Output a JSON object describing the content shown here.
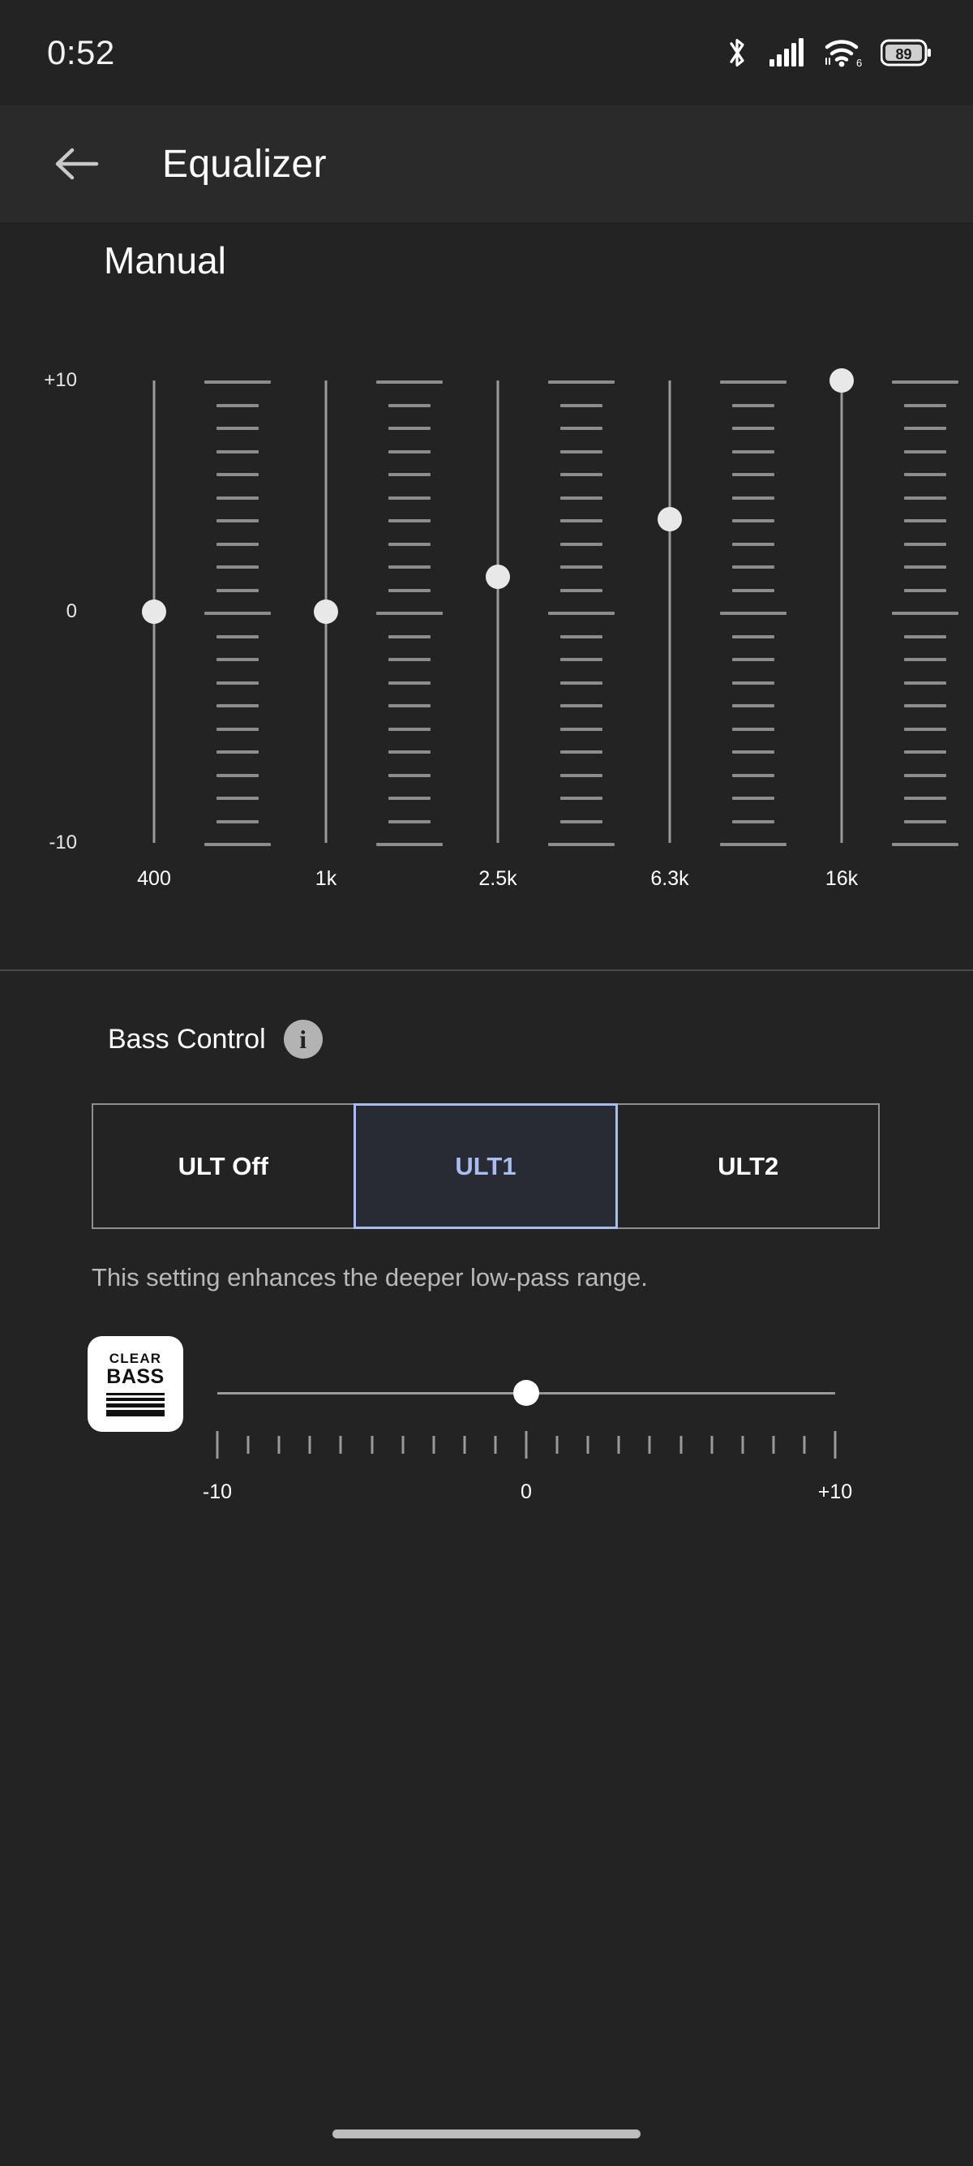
{
  "status_bar": {
    "time": "0:52",
    "battery_percent": "89",
    "wifi_generation": "6",
    "icons": [
      "bluetooth-icon",
      "cellular-signal-icon",
      "wifi-icon",
      "battery-icon"
    ]
  },
  "app_bar": {
    "back_icon": "back-arrow-icon",
    "title": "Equalizer"
  },
  "equalizer": {
    "preset_name": "Manual",
    "scale_labels": {
      "top": "+10",
      "middle": "0",
      "bottom": "-10"
    },
    "bands": [
      {
        "freq_label": "400",
        "value": 0
      },
      {
        "freq_label": "1k",
        "value": 0
      },
      {
        "freq_label": "2.5k",
        "value": 1.5
      },
      {
        "freq_label": "6.3k",
        "value": 4
      },
      {
        "freq_label": "16k",
        "value": 10
      }
    ],
    "range": {
      "min": -10,
      "max": 10
    }
  },
  "bass_control": {
    "title": "Bass Control",
    "info_icon": "info-icon",
    "info_glyph": "i",
    "options": [
      {
        "label": "ULT Off",
        "selected": false
      },
      {
        "label": "ULT1",
        "selected": true
      },
      {
        "label": "ULT2",
        "selected": false
      }
    ],
    "description": "This setting enhances the deeper low-pass range.",
    "accent_color": "#a9bdf0",
    "clear_bass": {
      "line1": "CLEAR",
      "line2": "BASS",
      "badge_name": "clear-bass-logo"
    },
    "slider": {
      "value": 0,
      "min_label": "-10",
      "mid_label": "0",
      "max_label": "+10",
      "min": -10,
      "max": 10,
      "tick_count": 21
    }
  },
  "nav_bar": {
    "handle": "gesture-handle"
  }
}
